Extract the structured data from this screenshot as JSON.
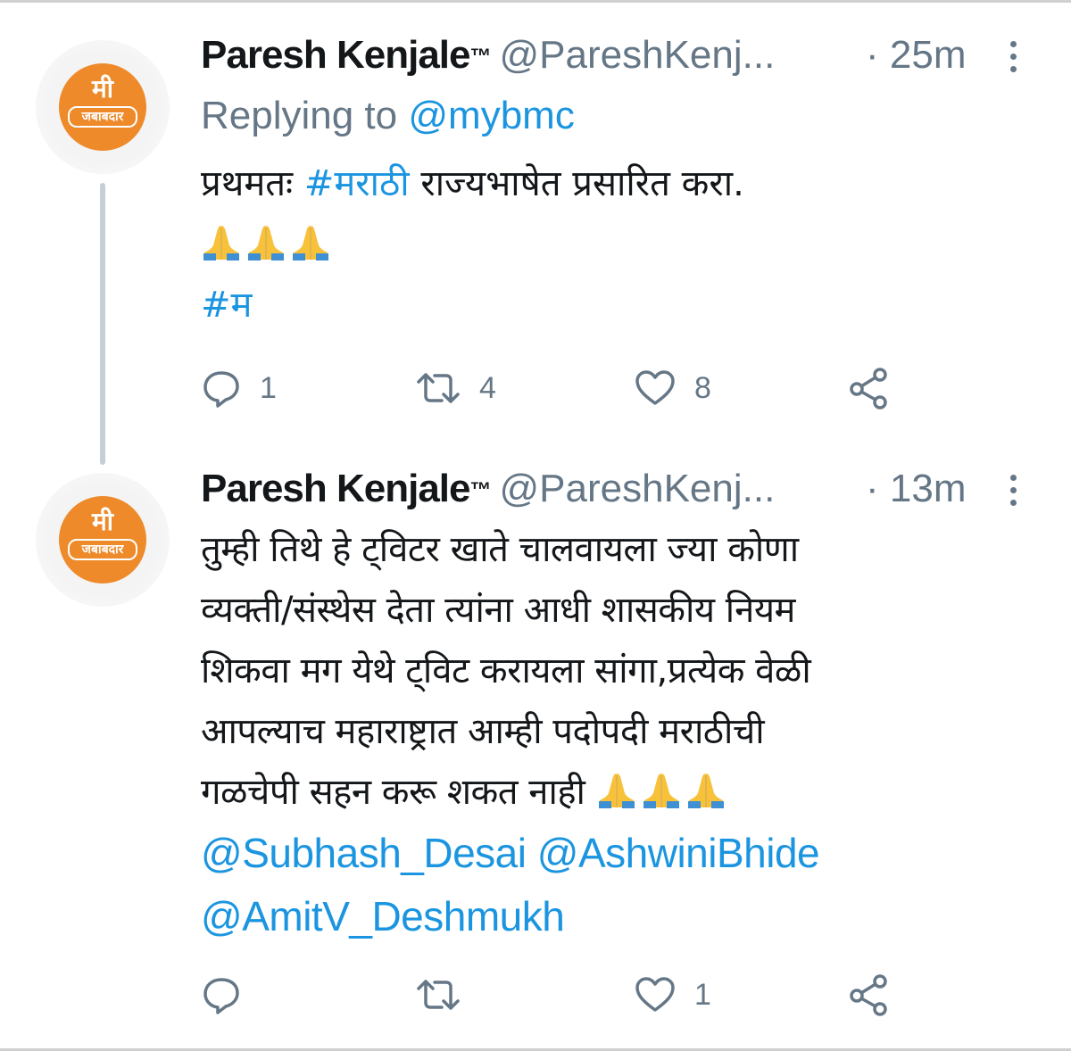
{
  "tweets": [
    {
      "author": "Paresh Kenjale",
      "tm": "™",
      "handle": "@PareshKenj...",
      "time": "· 25m",
      "replying_prefix": "Replying to",
      "replying_handle": "@mybmc",
      "line1_text": "प्रथमतः",
      "line1_hashtag": "#मराठी",
      "line1_rest": "राज्यभाषेत प्रसारित करा.",
      "hashtag2": "#म",
      "emoji": "folded-hands",
      "counts": {
        "reply": "1",
        "retweet": "4",
        "like": "8"
      }
    },
    {
      "author": "Paresh Kenjale",
      "tm": "™",
      "handle": "@PareshKenj...",
      "time": "· 13m",
      "lines": [
        "तुम्ही तिथे हे ट्विटर खाते चालवायला ज्या कोणा",
        "व्यक्ती/संस्थेस देता त्यांना आधी शासकीय नियम",
        "शिकवा मग येथे ट्विट करायला सांगा,प्रत्येक वेळी",
        "आपल्याच महाराष्ट्रात आम्ही पदोपदी मराठीची",
        "गळचेपी सहन करू शकत नाही"
      ],
      "mentions_line1": "@Subhash_Desai @AshwiniBhide",
      "mentions_line2": "@AmitV_Deshmukh",
      "emoji": "folded-hands",
      "counts": {
        "reply": "",
        "retweet": "",
        "like": "1"
      }
    }
  ],
  "avatar": {
    "line1": "मी",
    "line2": "जबाबदार",
    "color": "#ee8a2a"
  },
  "colors": {
    "link": "#1b95e0",
    "secondary": "#657786",
    "text": "#14171a"
  },
  "icons": [
    "reply-icon",
    "retweet-icon",
    "like-icon",
    "share-icon",
    "more-icon"
  ]
}
